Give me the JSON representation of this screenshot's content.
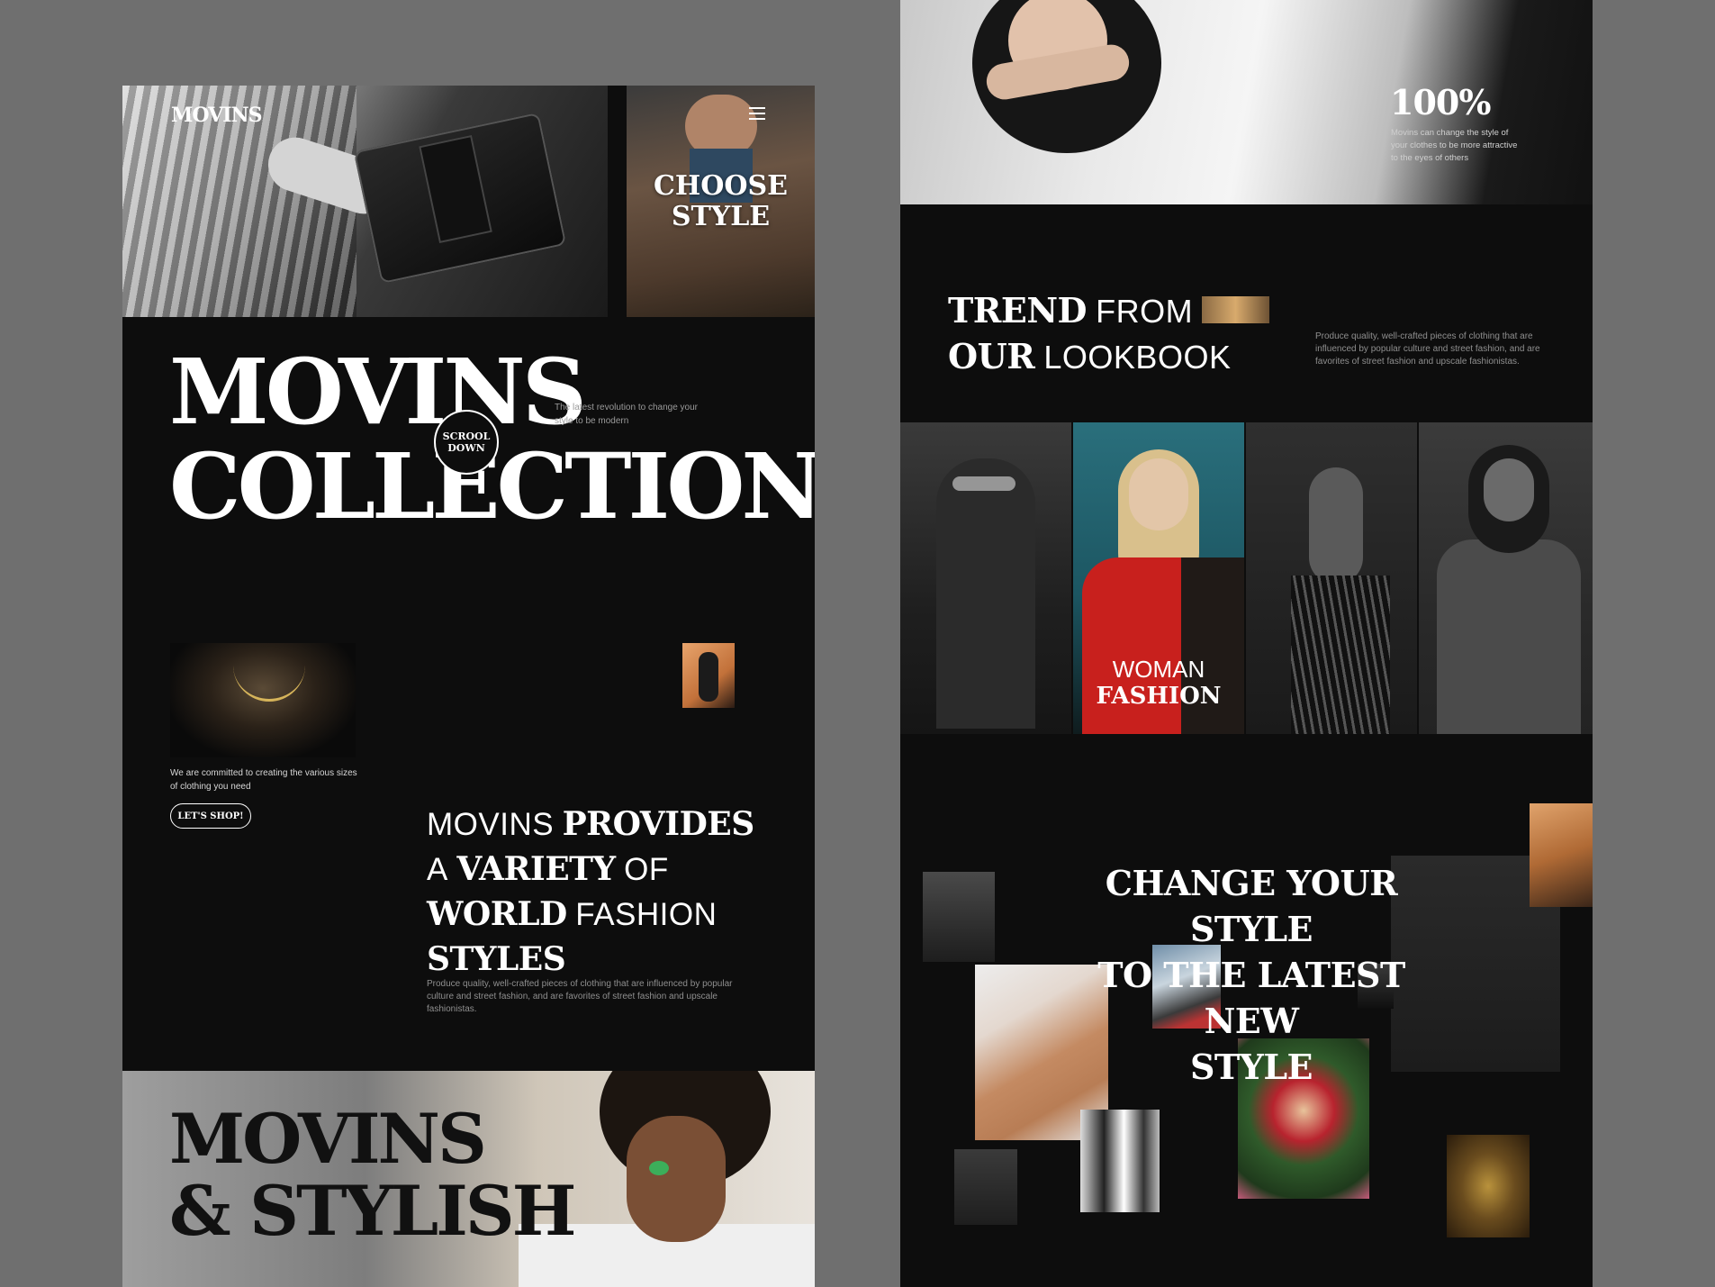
{
  "colors": {
    "background": "#6f6f6f",
    "panel": "#0d0d0d",
    "text": "#ffffff",
    "muted": "#8f8f8f"
  },
  "left": {
    "header": {
      "logo": "MOVINS",
      "menu_icon": "hamburger-menu-icon"
    },
    "hero": {
      "choose_style_line1": "CHOOSE",
      "choose_style_line2": "STYLE"
    },
    "title_line1": "MOVINS",
    "title_line2": "COLLECTIONS",
    "scroll_line1": "SCROOL",
    "scroll_line2": "DOWN",
    "tagline": "The latest revolution to change your style to be modern",
    "committed": "We are committed to creating the various sizes of clothing you need",
    "shop_button": "LET'S SHOP!",
    "provides": {
      "w1": "MOVINS",
      "w2": "PROVIDES",
      "w3": "A",
      "w4": "VARIETY",
      "w5": "OF",
      "w6": "WORLD",
      "w7": "FASHION",
      "w8": "STYLES"
    },
    "provides_desc": "Produce quality, well-crafted pieces of clothing that are influenced by popular culture and street fashion, and are favorites of street fashion and upscale fashionistas.",
    "stylish_line1": "MOVINS",
    "stylish_line2": "& STYLISH"
  },
  "right": {
    "percent": "100%",
    "percent_desc": "Movins can change the style of your clothes to be more attractive to the eyes of others",
    "trend": {
      "w1": "TREND",
      "w2": "FROM",
      "w3": "OUR",
      "w4": "LOOKBOOK"
    },
    "trend_desc": "Produce quality, well-crafted pieces of clothing that are influenced by popular culture and street fashion, and are favorites of street fashion and upscale fashionistas.",
    "woman": "WOMAN",
    "fashion": "FASHION",
    "change_line1": "CHANGE YOUR STYLE",
    "change_line2": "TO THE LATEST NEW",
    "change_line3": "STYLE"
  }
}
